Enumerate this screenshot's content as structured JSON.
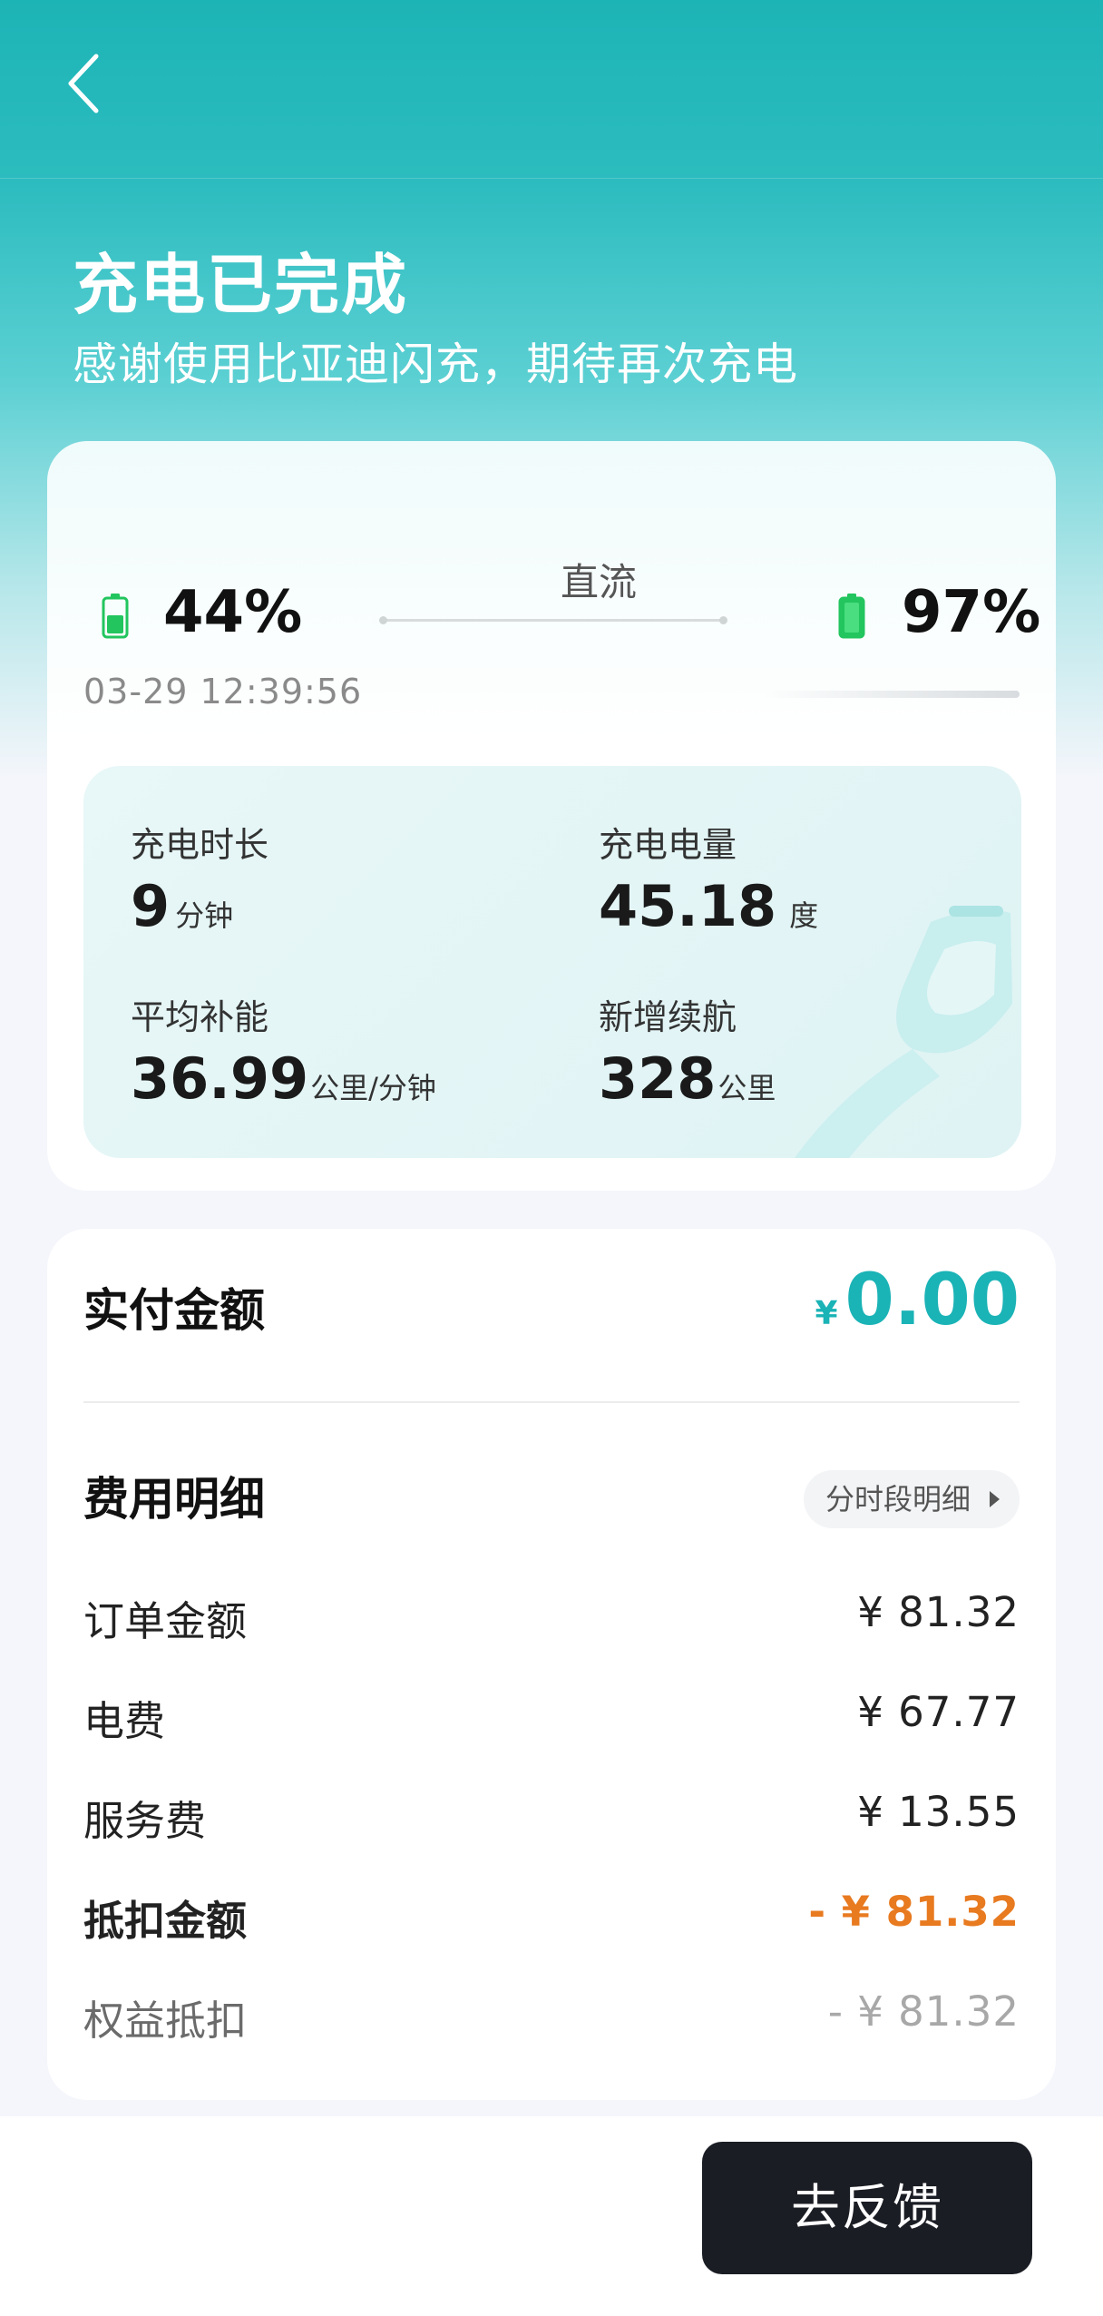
{
  "header": {
    "title": "充电已完成",
    "subtitle": "感谢使用比亚迪闪充，期待再次充电"
  },
  "charge_summary": {
    "mode": "直流",
    "start_percent": "44%",
    "end_percent": "97%",
    "start_time": "03-29 12:39:56"
  },
  "stats": {
    "duration": {
      "label": "充电时长",
      "value": "9",
      "unit": "分钟"
    },
    "energy": {
      "label": "充电电量",
      "value": "45.18",
      "unit": "度"
    },
    "avg_rate": {
      "label": "平均补能",
      "value": "36.99",
      "unit": "公里/分钟"
    },
    "range_added": {
      "label": "新增续航",
      "value": "328",
      "unit": "公里"
    }
  },
  "payment": {
    "label": "实付金额",
    "currency": "¥",
    "amount": "0.00"
  },
  "fee_detail": {
    "title": "费用明细",
    "time_breakdown_button": "分时段明细",
    "rows": [
      {
        "label": "订单金额",
        "value": "¥ 81.32"
      },
      {
        "label": "电费",
        "value": "¥ 67.77"
      },
      {
        "label": "服务费",
        "value": "¥ 13.55"
      },
      {
        "label": "抵扣金额",
        "value": "- ¥ 81.32"
      },
      {
        "label": "权益抵扣",
        "value": "- ¥ 81.32"
      }
    ]
  },
  "footer": {
    "feedback_button": "去反馈"
  },
  "colors": {
    "accent": "#1ab3b6",
    "battery": "#22c55e",
    "discount": "#e87a20",
    "button_dark": "#1b1d24"
  },
  "icons": [
    "back-arrow-icon",
    "battery-icon",
    "chevron-right-icon",
    "charging-gun-icon"
  ]
}
